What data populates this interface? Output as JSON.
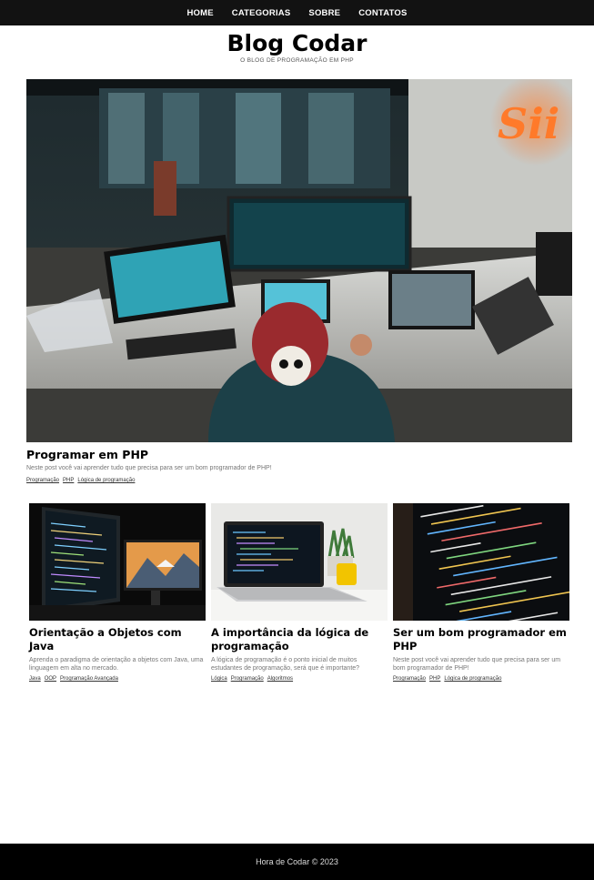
{
  "nav": {
    "items": [
      "HOME",
      "CATEGORIAS",
      "SOBRE",
      "CONTATOS"
    ]
  },
  "brand": {
    "title": "Blog Codar",
    "subtitle": "O BLOG DE PROGRAMAÇÃO EM PHP"
  },
  "hero": {
    "title": "Programar em PHP",
    "description": "Neste post você vai aprender tudo que precisa para ser um bom programador de PHP!",
    "tags": [
      "Programação",
      "PHP",
      "Lógica de programação"
    ]
  },
  "cards": [
    {
      "title": "Orientação a Objetos com Java",
      "description": "Aprenda o paradigma de orientação a objetos com Java, uma linguagem em alta no mercado.",
      "tags": [
        "Java",
        "OOP",
        "Programação Avançada"
      ]
    },
    {
      "title": "A importância da lógica de programação",
      "description": "A lógica de programação é o ponto inicial de muitos estudantes de programação, será que é importante?",
      "tags": [
        "Lógica",
        "Programação",
        "Algoritmos"
      ]
    },
    {
      "title": "Ser um bom programador em PHP",
      "description": "Neste post você vai aprender tudo que precisa para ser um bom programador de PHP!",
      "tags": [
        "Programação",
        "PHP",
        "Lógica de programação"
      ]
    }
  ],
  "footer": {
    "text": "Hora de Codar © 2023"
  },
  "colors": {
    "nav_bg": "#121212",
    "footer_bg": "#000000",
    "sign_glow": "#ff6a1a"
  }
}
